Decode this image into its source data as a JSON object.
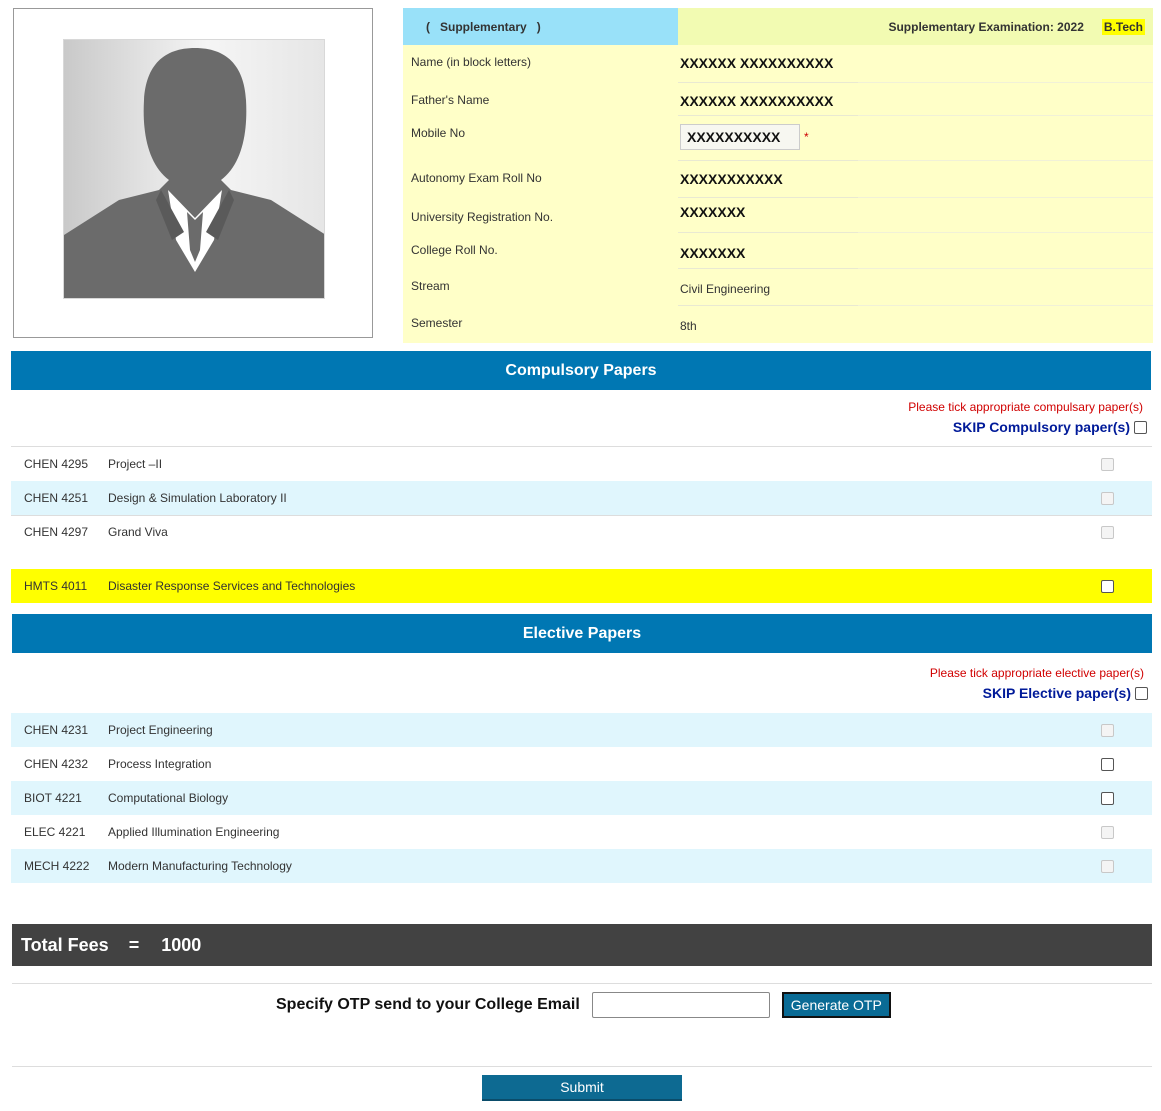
{
  "header": {
    "exam_type_open": "(",
    "exam_type": "Supplementary",
    "exam_type_close": ")",
    "exam_title": "Supplementary Examination: 2022",
    "degree": "B.Tech"
  },
  "student": {
    "fields": [
      {
        "label": "Name (in block letters)",
        "value": "XXXXXX XXXXXXXXXX"
      },
      {
        "label": "Father's Name",
        "value": "XXXXXX XXXXXXXXXX"
      },
      {
        "label": "Mobile No",
        "value": "XXXXXXXXXX",
        "required_mark": "*"
      },
      {
        "label": "Autonomy Exam Roll No",
        "value": "XXXXXXXXXXX"
      },
      {
        "label": "University Registration No.",
        "value": "XXXXXXX"
      },
      {
        "label": "College Roll No.",
        "value": "XXXXXXX"
      },
      {
        "label": "Stream",
        "value": "Civil Engineering"
      },
      {
        "label": "Semester",
        "value": "8th"
      }
    ]
  },
  "compulsory": {
    "heading": "Compulsory Papers",
    "notice": "Please tick appropriate compulsary paper(s)",
    "skip_label": "SKIP Compulsory paper(s)",
    "papers": [
      {
        "code": "CHEN 4295",
        "title": "Project –II",
        "enabled": false
      },
      {
        "code": "CHEN 4251",
        "title": "Design & Simulation Laboratory II",
        "enabled": false
      },
      {
        "code": "CHEN 4297",
        "title": "Grand Viva",
        "enabled": false
      },
      {
        "code": "HMTS 4011",
        "title": "Disaster Response Services and Technologies",
        "enabled": true
      }
    ]
  },
  "elective": {
    "heading": "Elective Papers",
    "notice": "Please tick appropriate elective paper(s)",
    "skip_label": "SKIP Elective paper(s)",
    "papers": [
      {
        "code": "CHEN 4231",
        "title": "Project Engineering",
        "enabled": false
      },
      {
        "code": "CHEN 4232",
        "title": "Process Integration",
        "enabled": true
      },
      {
        "code": "BIOT 4221",
        "title": "Computational Biology",
        "enabled": true
      },
      {
        "code": "ELEC 4221",
        "title": "Applied Illumination Engineering",
        "enabled": false
      },
      {
        "code": "MECH 4222",
        "title": "Modern Manufacturing Technology",
        "enabled": false
      }
    ]
  },
  "fees": {
    "label": "Total Fees",
    "equals": "=",
    "amount": "1000"
  },
  "otp": {
    "label": "Specify OTP send to your College Email",
    "value": "",
    "button": "Generate OTP"
  },
  "submit": {
    "label": "Submit"
  },
  "colors": {
    "section_header": "#0077b3",
    "highlight_row": "#ffff00",
    "info_bg": "#ffffc8",
    "notice_red": "#d00000"
  }
}
